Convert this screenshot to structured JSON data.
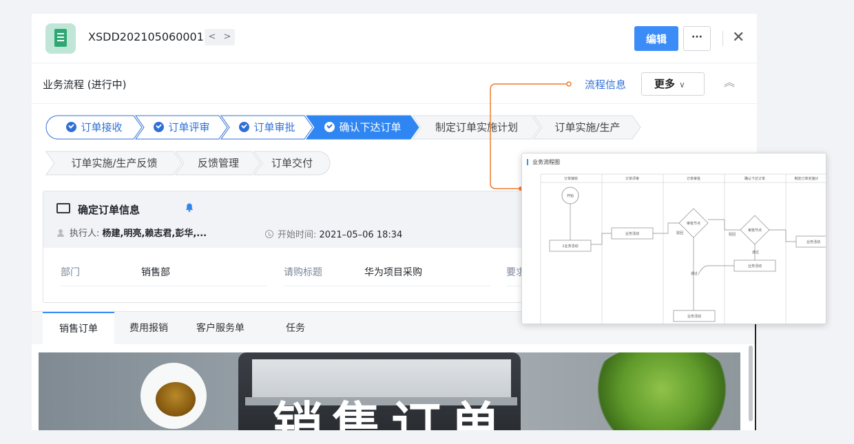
{
  "header": {
    "order_no": "XSDD202105060001",
    "prev_glyph": "<",
    "next_glyph": ">",
    "edit_label": "编辑",
    "more_label": "···",
    "close_glyph": "✕",
    "doc_icon": "document-icon"
  },
  "process": {
    "title": "业务流程 (进行中)",
    "flow_info": "流程信息",
    "more_label": "更多",
    "more_chevron": "∨",
    "collapse_glyph": "︽"
  },
  "steps": [
    {
      "label": "订单接收",
      "state": "done"
    },
    {
      "label": "订单评审",
      "state": "done"
    },
    {
      "label": "订单审批",
      "state": "done"
    },
    {
      "label": "确认下达订单",
      "state": "active"
    },
    {
      "label": "制定订单实施计划",
      "state": "todo"
    },
    {
      "label": "订单实施/生产",
      "state": "todo"
    },
    {
      "label": "订单实施/生产反馈",
      "state": "todo"
    },
    {
      "label": "反馈管理",
      "state": "todo"
    },
    {
      "label": "订单交付",
      "state": "todo"
    }
  ],
  "task": {
    "title": "确定订单信息",
    "executor_label": "执行人:",
    "executors": "杨建,明亮,赖志君,彭华,...",
    "start_label": "开始时间:",
    "start_value": "2021–05–06 18:34",
    "fields": [
      {
        "label": "部门",
        "value": "销售部"
      },
      {
        "label": "请购标题",
        "value": "华为项目采购"
      },
      {
        "label": "要求",
        "value": ""
      }
    ]
  },
  "tabs": [
    {
      "label": "销售订单",
      "active": true
    },
    {
      "label": "费用报销",
      "active": false
    },
    {
      "label": "客户服务单",
      "active": false
    },
    {
      "label": "任务",
      "active": false
    }
  ],
  "banner": {
    "text": "销售订单"
  },
  "flowchart": {
    "title": "业务流程图",
    "lanes": [
      "订单接收",
      "订单评审",
      "订单审批",
      "确认下达订单",
      "制定订单实施计"
    ],
    "start_label": "开始",
    "activity_label": "业务活动",
    "activity1_label": "1业务活动",
    "decision_label": "审批节点",
    "edge_reject": "驳回",
    "edge_pass": "通过"
  },
  "colors": {
    "primary": "#3b8cf7",
    "link": "#2f6fd6",
    "active_step": "#2f86f3",
    "connector": "#f07b2a",
    "doc_icon_bg": "#bfe6d6"
  }
}
